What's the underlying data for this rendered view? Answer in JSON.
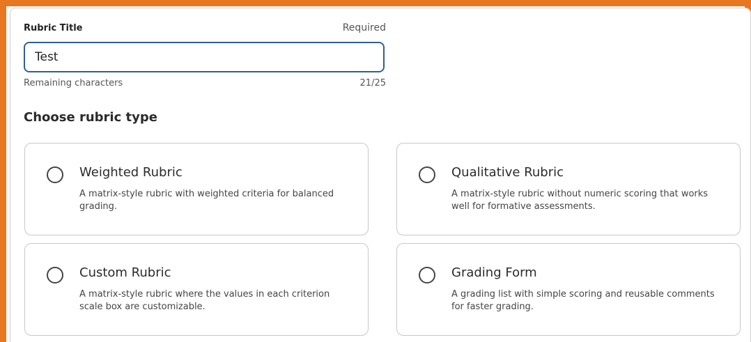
{
  "rubric_title": {
    "label": "Rubric Title",
    "required_text": "Required",
    "value": "Test",
    "remaining_label": "Remaining characters",
    "count": "21/25"
  },
  "rubric_type": {
    "heading": "Choose rubric type",
    "options": [
      {
        "title": "Weighted Rubric",
        "description": "A matrix-style rubric with weighted criteria for balanced grading."
      },
      {
        "title": "Qualitative Rubric",
        "description": "A matrix-style rubric without numeric scoring that works well for formative assessments."
      },
      {
        "title": "Custom Rubric",
        "description": "A matrix-style rubric where the values in each criterion scale box are customizable."
      },
      {
        "title": "Grading Form",
        "description": "A grading list with simple scoring and reusable comments for faster grading."
      }
    ]
  },
  "colors": {
    "frame_accent": "#e87722",
    "input_focus_border": "#2f5e9e"
  }
}
